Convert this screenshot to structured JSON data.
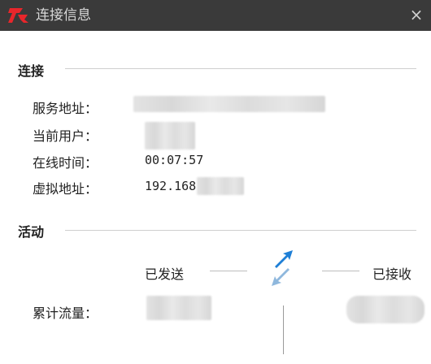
{
  "window": {
    "title": "连接信息",
    "close_glyph": "×"
  },
  "logo": {
    "text": "R",
    "color": "#e8262b"
  },
  "connection": {
    "section_title": "连接",
    "service_address_label": "服务地址：",
    "current_user_label": "当前用户：",
    "online_time_label": "在线时间：",
    "online_time_value": "00:07:57",
    "virtual_address_label": "虚拟地址：",
    "virtual_address_value": "192.168"
  },
  "activity": {
    "section_title": "活动",
    "sent_label": "已发送",
    "received_label": "已接收",
    "traffic_label": "累计流量：",
    "arrow_up_color": "#1e7fd6",
    "arrow_down_color": "#8fb8dd"
  }
}
